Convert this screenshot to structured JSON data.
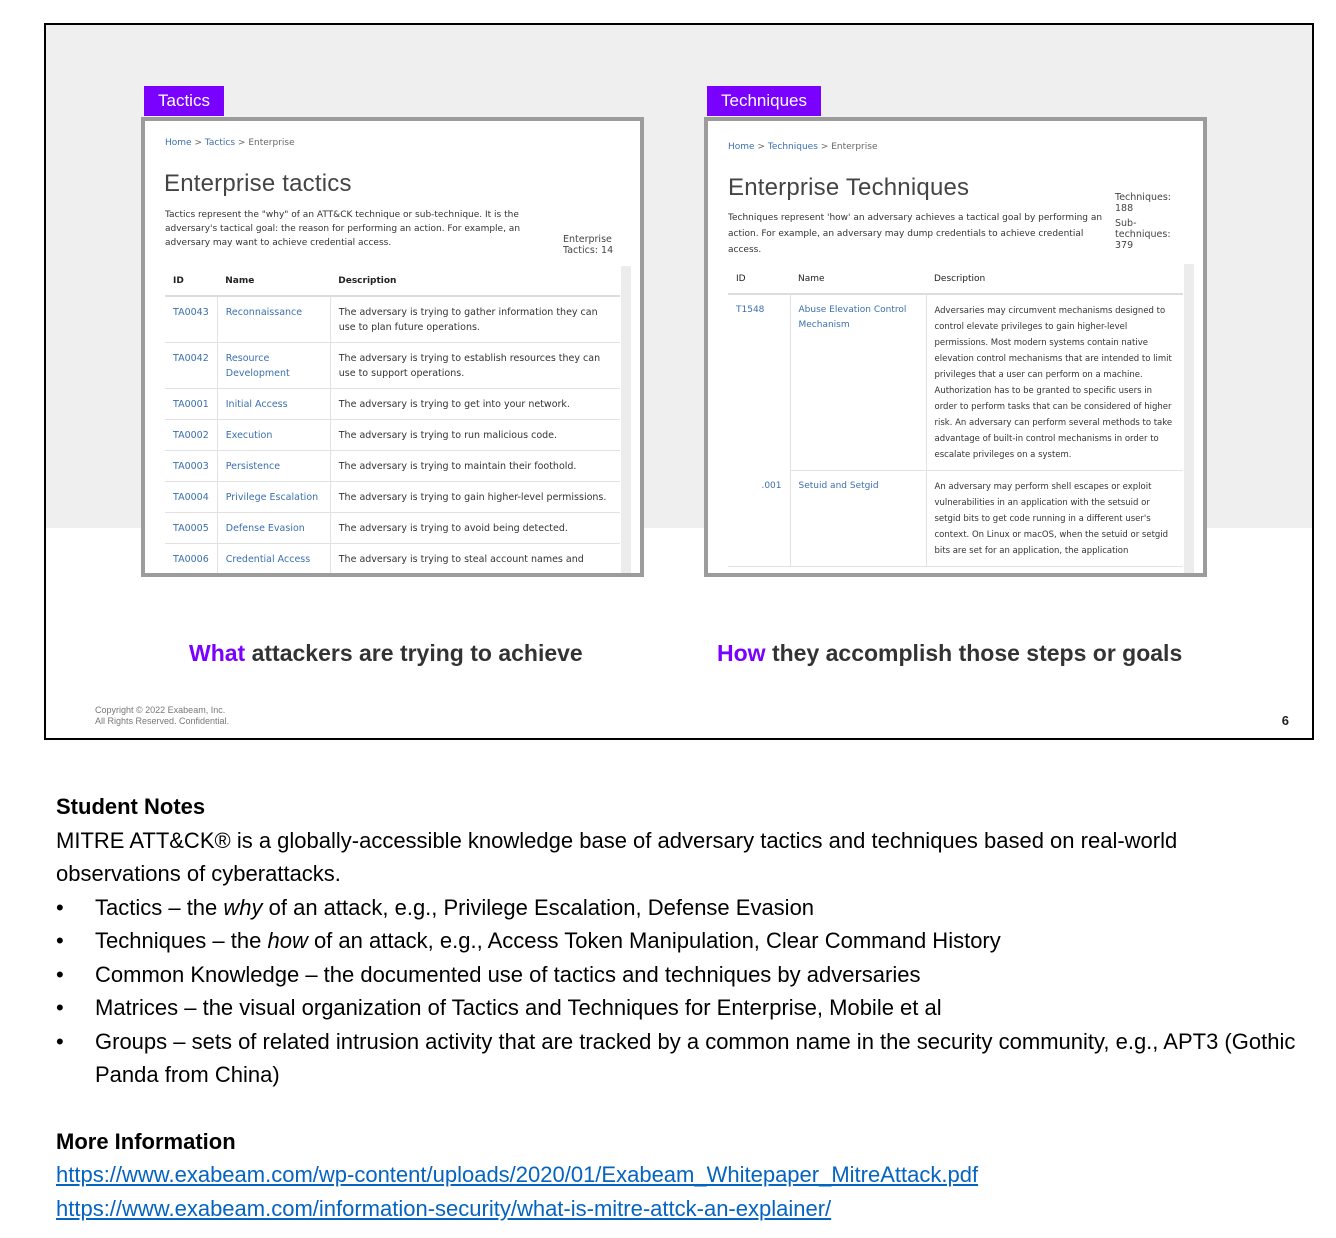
{
  "slide": {
    "tactics_tag": "Tactics",
    "techniques_tag": "Techniques",
    "tactics_shot": {
      "breadcrumb": {
        "home": "Home",
        "sep1": ">",
        "section": "Tactics",
        "sep2": ">",
        "current": "Enterprise"
      },
      "title": "Enterprise tactics",
      "description": "Tactics represent the \"why\" of an ATT&CK technique or sub-technique. It is the adversary's tactical goal: the reason for performing an action. For example, an adversary may want to achieve credential access.",
      "stat_line1": "Enterprise",
      "stat_line2": "Tactics: 14",
      "columns": [
        "ID",
        "Name",
        "Description"
      ],
      "rows": [
        {
          "id": "TA0043",
          "name": "Reconnaissance",
          "desc": "The adversary is trying to gather information they can use to plan future operations."
        },
        {
          "id": "TA0042",
          "name": "Resource Development",
          "desc": "The adversary is trying to establish resources they can use to support operations."
        },
        {
          "id": "TA0001",
          "name": "Initial Access",
          "desc": "The adversary is trying to get into your network."
        },
        {
          "id": "TA0002",
          "name": "Execution",
          "desc": "The adversary is trying to run malicious code."
        },
        {
          "id": "TA0003",
          "name": "Persistence",
          "desc": "The adversary is trying to maintain their foothold."
        },
        {
          "id": "TA0004",
          "name": "Privilege Escalation",
          "desc": "The adversary is trying to gain higher-level permissions."
        },
        {
          "id": "TA0005",
          "name": "Defense Evasion",
          "desc": "The adversary is trying to avoid being detected."
        },
        {
          "id": "TA0006",
          "name": "Credential Access",
          "desc": "The adversary is trying to steal account names and"
        }
      ]
    },
    "techniques_shot": {
      "breadcrumb": {
        "home": "Home",
        "sep1": ">",
        "section": "Techniques",
        "sep2": ">",
        "current": "Enterprise"
      },
      "title": "Enterprise Techniques",
      "description": "Techniques represent 'how' an adversary achieves a tactical goal by performing an action. For example, an adversary may dump credentials to achieve credential access.",
      "stat_line1": "Techniques:",
      "stat_line2": "188",
      "stat_line3": "Sub-",
      "stat_line4": "techniques:",
      "stat_line5": "379",
      "columns": [
        "ID",
        "Name",
        "Description"
      ],
      "rows": [
        {
          "id": "T1548",
          "sub": "",
          "name": "Abuse Elevation Control Mechanism",
          "desc": "Adversaries may circumvent mechanisms designed to control elevate privileges to gain higher-level permissions. Most modern systems contain native elevation control mechanisms that are intended to limit privileges that a user can perform on a machine. Authorization has to be granted to specific users in order to perform tasks that can be considered of higher risk. An adversary can perform several methods to take advantage of built-in control mechanisms in order to escalate privileges on a system."
        },
        {
          "id": "",
          "sub": ".001",
          "name": "Setuid and Setgid",
          "desc": "An adversary may perform shell escapes or exploit vulnerabilities in an application with the setsuid or setgid bits to get code running in a different user's context. On Linux or macOS, when the setuid or setgid bits are set for an application, the application"
        }
      ]
    },
    "caption_left_hl": "What",
    "caption_left_rest": " attackers are trying to achieve",
    "caption_right_hl": "How",
    "caption_right_rest": " they accomplish those steps or goals",
    "copyright_line1": "Copyright © 2022 Exabeam, Inc.",
    "copyright_line2": "All Rights Reserved. Confidential.",
    "page_number": "6"
  },
  "notes": {
    "heading": "Student Notes",
    "intro": "MITRE ATT&CK® is a globally-accessible knowledge base of adversary tactics and techniques based on real-world observations of cyberattacks.",
    "bullets": [
      {
        "pre": "Tactics – the ",
        "em": "why",
        "post": " of an attack, e.g., Privilege Escalation, Defense Evasion"
      },
      {
        "pre": "Techniques – the ",
        "em": "how",
        "post": " of an attack, e.g., Access Token Manipulation, Clear Command History"
      },
      {
        "pre": "Common Knowledge – the documented use of tactics and techniques by adversaries",
        "em": "",
        "post": ""
      },
      {
        "pre": "Matrices – the visual organization of Tactics and Techniques for Enterprise, Mobile et al",
        "em": "",
        "post": ""
      },
      {
        "pre": "Groups – sets of related intrusion activity that are tracked by a common name in the security community, e.g., APT3 (Gothic Panda from China)",
        "em": "",
        "post": ""
      }
    ],
    "bullet_char": "•",
    "more_heading": "More Information",
    "links": [
      "https://www.exabeam.com/wp-content/uploads/2020/01/Exabeam_Whitepaper_MitreAttack.pdf",
      "https://www.exabeam.com/information-security/what-is-mitre-attck-an-explainer/"
    ]
  }
}
